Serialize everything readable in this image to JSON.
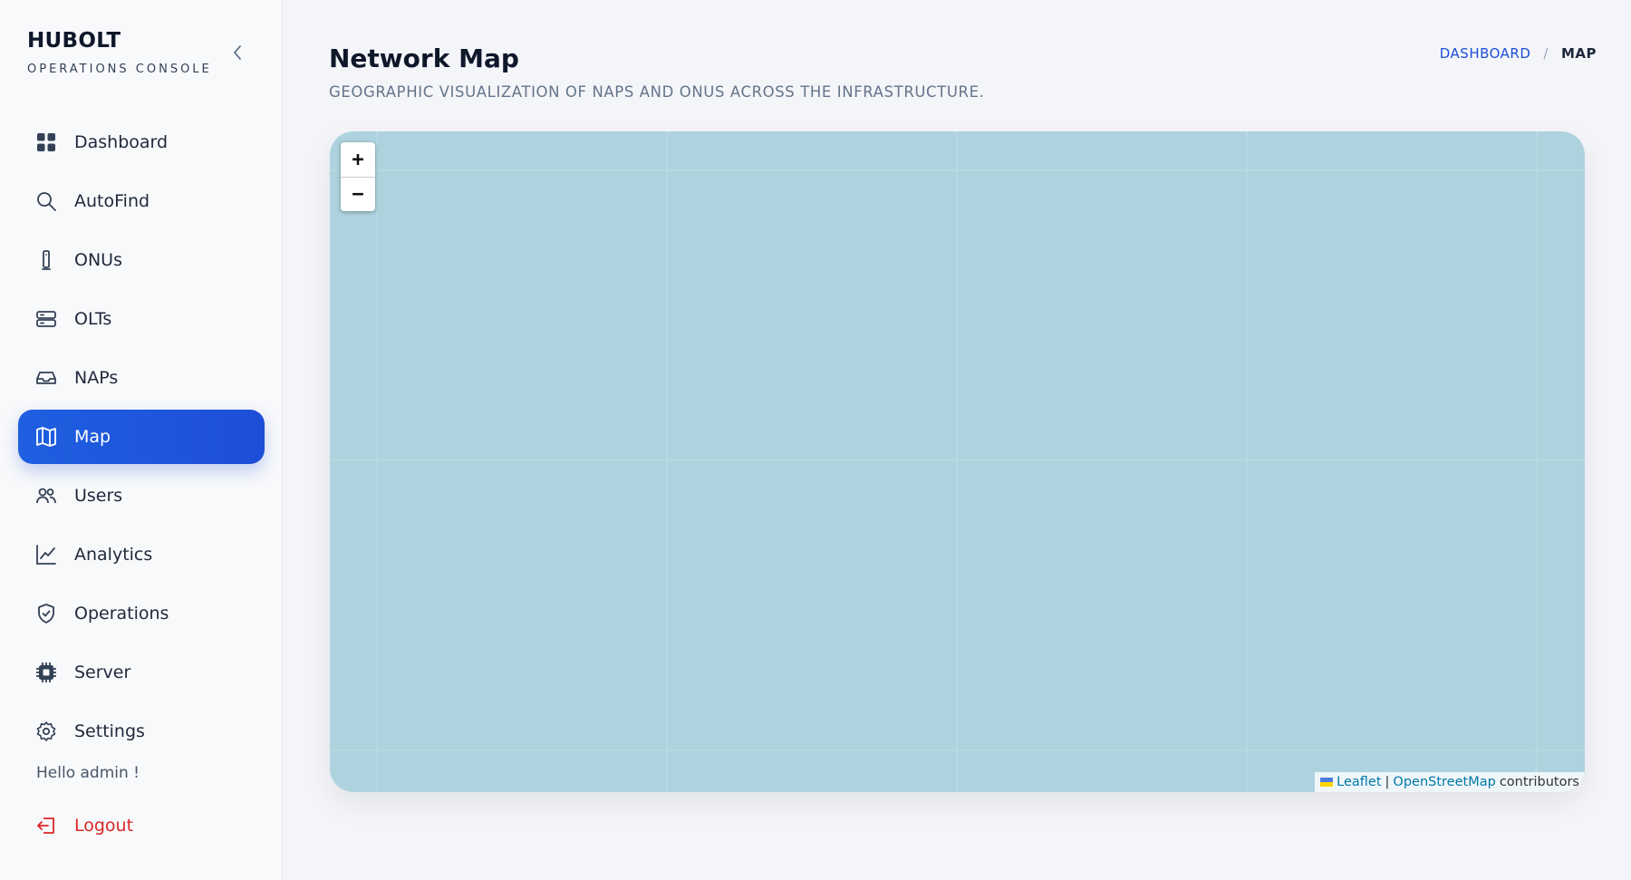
{
  "brand": {
    "title": "HUBOLT",
    "subtitle": "OPERATIONS CONSOLE"
  },
  "sidebar": {
    "items": [
      {
        "label": "Dashboard",
        "icon": "grid-icon",
        "active": false
      },
      {
        "label": "AutoFind",
        "icon": "search-icon",
        "active": false
      },
      {
        "label": "ONUs",
        "icon": "device-icon",
        "active": false
      },
      {
        "label": "OLTs",
        "icon": "server-rack-icon",
        "active": false
      },
      {
        "label": "NAPs",
        "icon": "inbox-icon",
        "active": false
      },
      {
        "label": "Map",
        "icon": "map-icon",
        "active": true
      },
      {
        "label": "Users",
        "icon": "users-icon",
        "active": false
      },
      {
        "label": "Analytics",
        "icon": "chart-line-icon",
        "active": false
      },
      {
        "label": "Operations",
        "icon": "shield-check-icon",
        "active": false
      },
      {
        "label": "Server",
        "icon": "chip-icon",
        "active": false
      },
      {
        "label": "Settings",
        "icon": "gear-icon",
        "active": false
      }
    ],
    "greeting": "Hello admin !",
    "logout_label": "Logout"
  },
  "header": {
    "title": "Network Map",
    "subtitle": "GEOGRAPHIC VISUALIZATION OF NAPS AND ONUS ACROSS THE INFRASTRUCTURE.",
    "breadcrumb": {
      "link": "DASHBOARD",
      "separator": "/",
      "current": "MAP"
    }
  },
  "map": {
    "zoom_in": "+",
    "zoom_out": "−",
    "attribution": {
      "leaflet": "Leaflet",
      "divider": "|",
      "osm": "OpenStreetMap",
      "suffix": "contributors"
    },
    "water_color": "#aed3de"
  },
  "colors": {
    "accent": "#1d4ed8",
    "danger": "#dc2626"
  }
}
